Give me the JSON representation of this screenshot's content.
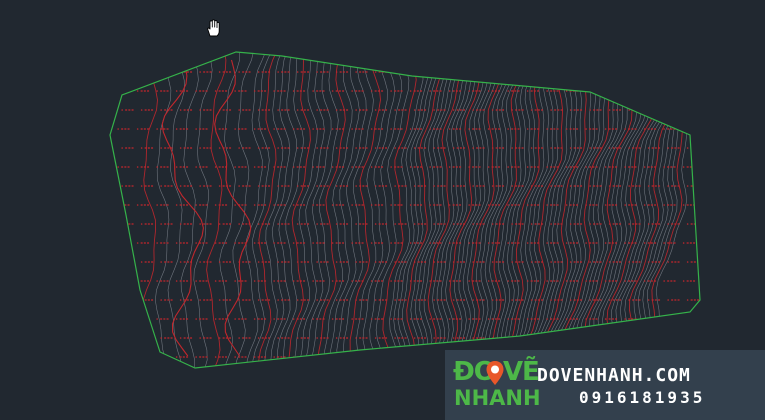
{
  "canvas": {
    "background": "#212830",
    "boundary_color": "#35b24a",
    "contour_color": "#8a8f98",
    "index_contour_color": "#c0272d",
    "label_color": "#c0272d",
    "cursor_icon": "pan-hand-icon"
  },
  "watermark": {
    "brand_top": "ĐO VẼ",
    "brand_bottom": "NHANH",
    "website": "DOVENHANH.COM",
    "phone": "0916181935",
    "brand_color": "#4db848",
    "text_color": "#ffffff",
    "background": "#33404d"
  }
}
